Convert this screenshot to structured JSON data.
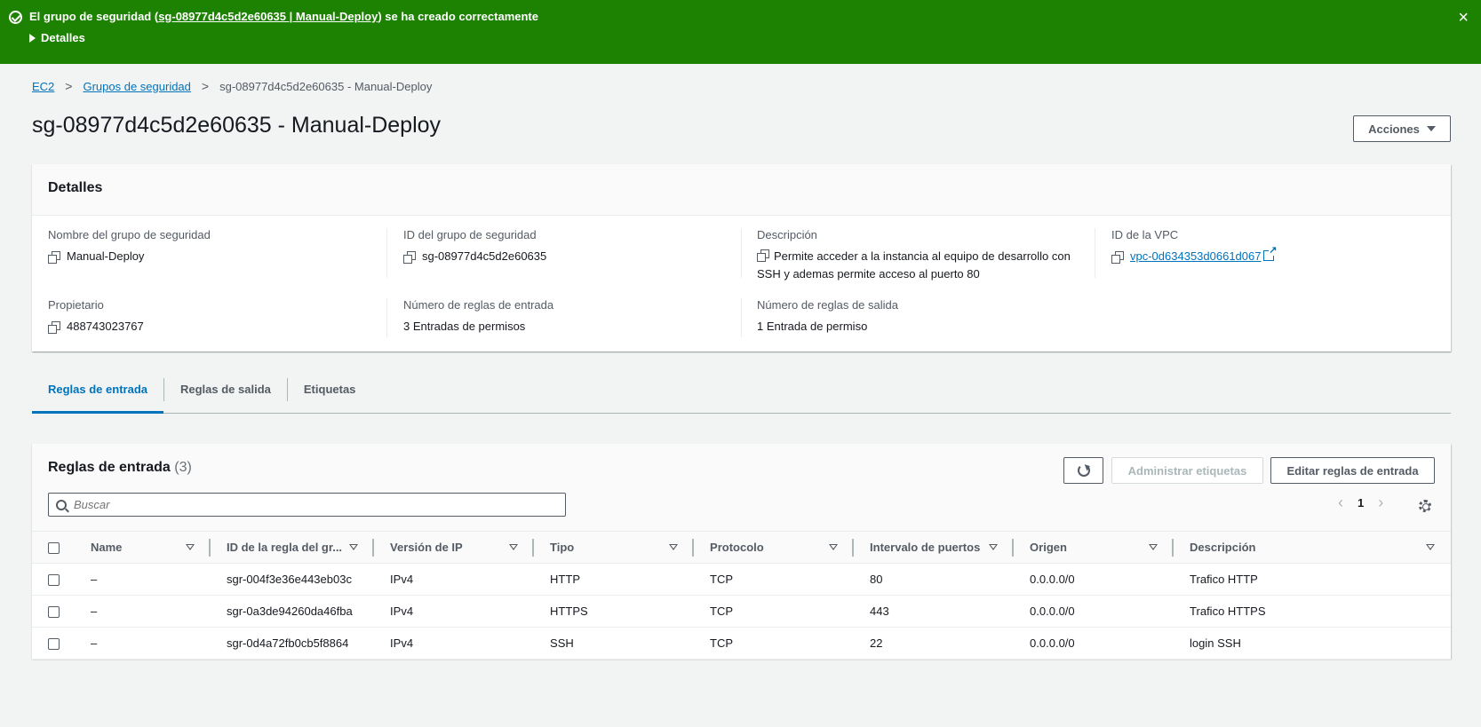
{
  "flash": {
    "prefix": "El grupo de seguridad (",
    "link": "sg-08977d4c5d2e60635 | Manual-Deploy",
    "suffix": ") se ha creado correctamente",
    "details": "Detalles",
    "close": "×",
    "color": "#1d8102"
  },
  "breadcrumb": {
    "items": [
      "EC2",
      "Grupos de seguridad"
    ],
    "current": "sg-08977d4c5d2e60635 - Manual-Deploy",
    "separator": ">"
  },
  "page": {
    "title": "sg-08977d4c5d2e60635 - Manual-Deploy",
    "actions": "Acciones"
  },
  "details": {
    "heading": "Detalles",
    "group_name_label": "Nombre del grupo de seguridad",
    "group_name": "Manual-Deploy",
    "group_id_label": "ID del grupo de seguridad",
    "group_id": "sg-08977d4c5d2e60635",
    "description_label": "Descripción",
    "description": "Permite acceder a la instancia al equipo de desarrollo con SSH y ademas permite acceso al puerto 80",
    "vpc_label": "ID de la VPC",
    "vpc": "vpc-0d634353d0661d067",
    "owner_label": "Propietario",
    "owner": "488743023767",
    "inbound_count_label": "Número de reglas de entrada",
    "inbound_count": "3 Entradas de permisos",
    "outbound_count_label": "Número de reglas de salida",
    "outbound_count": "1 Entrada de permiso"
  },
  "tabs": [
    "Reglas de entrada",
    "Reglas de salida",
    "Etiquetas"
  ],
  "rules": {
    "title": "Reglas de entrada",
    "count": "(3)",
    "manage_tags": "Administrar etiquetas",
    "edit_rules": "Editar reglas de entrada",
    "search_placeholder": "Buscar",
    "page": "1",
    "prev": "‹",
    "next": "›",
    "columns": [
      "Name",
      "ID de la regla del gr...",
      "Versión de IP",
      "Tipo",
      "Protocolo",
      "Intervalo de puertos",
      "Origen",
      "Descripción"
    ],
    "rows": [
      [
        "–",
        "sgr-004f3e36e443eb03c",
        "IPv4",
        "HTTP",
        "TCP",
        "80",
        "0.0.0.0/0",
        "Trafico HTTP"
      ],
      [
        "–",
        "sgr-0a3de94260da46fba",
        "IPv4",
        "HTTPS",
        "TCP",
        "443",
        "0.0.0.0/0",
        "Trafico HTTPS"
      ],
      [
        "–",
        "sgr-0d4a72fb0cb5f8864",
        "IPv4",
        "SSH",
        "TCP",
        "22",
        "0.0.0.0/0",
        "login SSH"
      ]
    ]
  }
}
